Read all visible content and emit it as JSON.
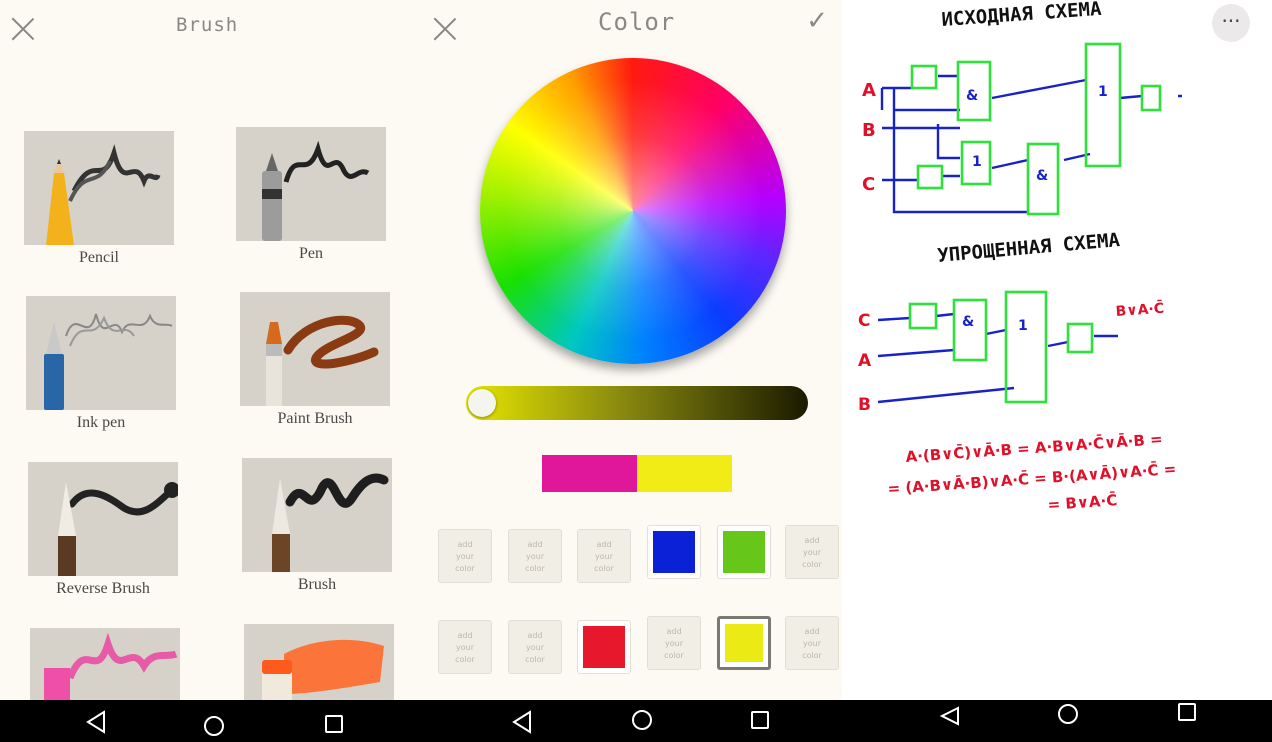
{
  "brush_panel": {
    "title": "Brush",
    "items": [
      {
        "label": "Pencil"
      },
      {
        "label": "Pen"
      },
      {
        "label": "Ink pen"
      },
      {
        "label": "Paint Brush"
      },
      {
        "label": "Reverse Brush"
      },
      {
        "label": "Brush"
      },
      {
        "label": ""
      },
      {
        "label": ""
      }
    ]
  },
  "color_panel": {
    "title": "Color",
    "selected_color": "#ffff00",
    "preview_old": "#e0179b",
    "preview_new": "#f2ec16",
    "placeholder_line1": "add",
    "placeholder_line2": "your",
    "placeholder_line3": "color",
    "swatches": [
      "",
      "",
      "",
      "#0a21d6",
      "#66c71a",
      "",
      "",
      "",
      "#e8182c",
      "",
      "#ecea14",
      ""
    ]
  },
  "sketch_panel": {
    "heading_original": "ИСХОДНАЯ СХЕМА",
    "heading_simplified": "УПРОЩЕННАЯ СХЕМА",
    "inputs_top": [
      "A",
      "B",
      "C"
    ],
    "inputs_bottom": [
      "C",
      "A",
      "B"
    ],
    "gate_and": "&",
    "gate_or": "1",
    "result": "B∨A·C̄",
    "eq1": "A·(B∨C̄)∨Ā·B = A·B∨A·C̄∨Ā·B =",
    "eq2": "= (A·B∨Ā·B)∨A·C̄ = B·(A∨Ā)∨A·C̄ =",
    "eq3": "= B∨A·C̄"
  },
  "colors": {
    "ink_red": "#e0102a",
    "ink_blue": "#1822c8",
    "ink_green": "#2ee23c"
  },
  "icons": [
    "close-icon",
    "check-icon",
    "more-icon",
    "back-icon",
    "home-icon",
    "recents-icon"
  ]
}
